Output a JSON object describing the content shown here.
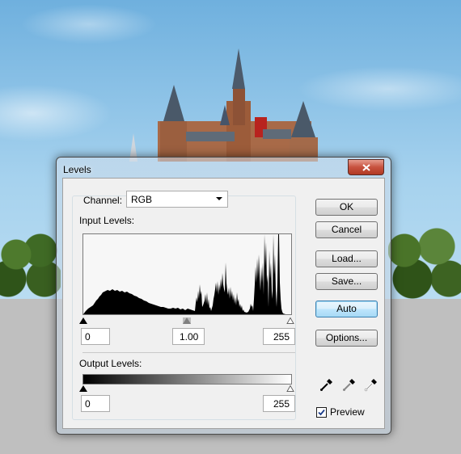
{
  "dialog": {
    "title": "Levels",
    "close_icon": "close-x-icon"
  },
  "channel": {
    "label": "Channel:",
    "value": "RGB"
  },
  "input_levels": {
    "label": "Input Levels:",
    "black": "0",
    "gamma": "1.00",
    "white": "255"
  },
  "output_levels": {
    "label": "Output Levels:",
    "black": "0",
    "white": "255"
  },
  "buttons": {
    "ok": "OK",
    "cancel": "Cancel",
    "load": "Load...",
    "save": "Save...",
    "auto": "Auto",
    "options": "Options..."
  },
  "preview": {
    "label": "Preview",
    "checked": true
  },
  "eyedroppers": [
    "black-eyedropper-icon",
    "gray-eyedropper-icon",
    "white-eyedropper-icon"
  ],
  "colors": {
    "sky": "#8cc4e8",
    "close_button": "#c7513e",
    "default_button_border": "#3c7fb1"
  }
}
